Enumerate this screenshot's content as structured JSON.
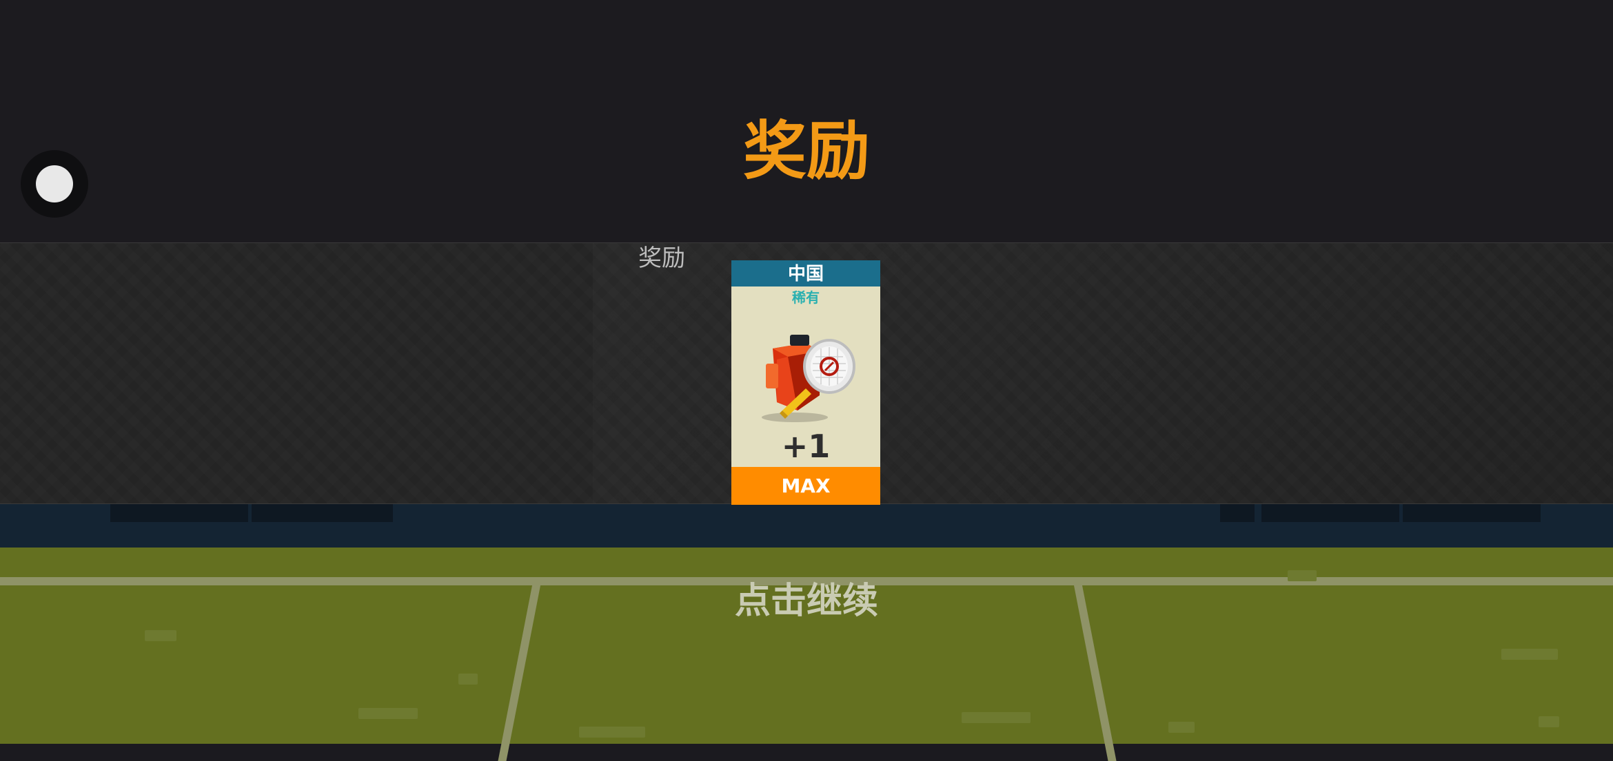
{
  "title": "奖励",
  "reward_section": {
    "label": "奖励"
  },
  "card": {
    "country": "中国",
    "rarity": "稀有",
    "count": "+1",
    "level": "MAX",
    "icon": "red-racket-bag-icon"
  },
  "continue_prompt": "点击继续",
  "colors": {
    "title": "#f39a16",
    "card_header": "#1b6e8c",
    "card_footer": "#ff8c00",
    "rarity": "#2ab0b0",
    "court": "#647020"
  }
}
